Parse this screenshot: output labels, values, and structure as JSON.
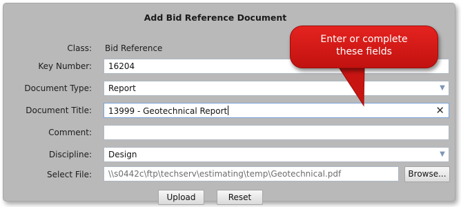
{
  "dialog": {
    "title": "Add Bid Reference Document",
    "class_label": "Class:",
    "class_value": "Bid Reference",
    "key_number": {
      "label": "Key Number:",
      "value": "16204"
    },
    "document_type": {
      "label": "Document Type:",
      "value": "Report"
    },
    "document_title": {
      "label": "Document Title:",
      "value": "13999 - Geotechnical Report"
    },
    "comment": {
      "label": "Comment:",
      "value": ""
    },
    "discipline": {
      "label": "Discipline:",
      "value": "Design"
    },
    "select_file": {
      "label": "Select File:",
      "value": "\\\\s0442c\\ftp\\techserv\\estimating\\temp\\Geotechnical.pdf",
      "browse_label": "Browse..."
    },
    "upload_label": "Upload",
    "reset_label": "Reset"
  },
  "callout": {
    "line1": "Enter or complete",
    "line2": "these fields"
  },
  "colors": {
    "panel": "#b9b9b9",
    "callout": "#d81b17"
  },
  "icons": {
    "dropdown": "chevron-down-icon",
    "clear": "close-icon"
  }
}
